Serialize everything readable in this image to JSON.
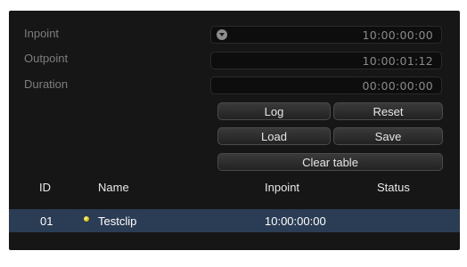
{
  "form": {
    "inpoint_label": "Inpoint",
    "outpoint_label": "Outpoint",
    "duration_label": "Duration",
    "inpoint_value": "10:00:00:00",
    "outpoint_value": "10:00:01:12",
    "duration_value": "00:00:00:00"
  },
  "buttons": {
    "log": "Log",
    "reset": "Reset",
    "load": "Load",
    "save": "Save",
    "clear_table": "Clear table"
  },
  "table": {
    "headers": {
      "id": "ID",
      "name": "Name",
      "inpoint": "Inpoint",
      "status": "Status"
    },
    "rows": [
      {
        "id": "01",
        "name": "Testclip",
        "inpoint": "10:00:00:00",
        "status": ""
      }
    ]
  },
  "colors": {
    "panel_bg": "#161616",
    "selection": "#2b3d55",
    "clip_dot": "#d8c400"
  },
  "icons": {
    "inpoint_dropdown": "chevron-down-circle-icon",
    "clip_marker": "yellow-dot-icon"
  }
}
